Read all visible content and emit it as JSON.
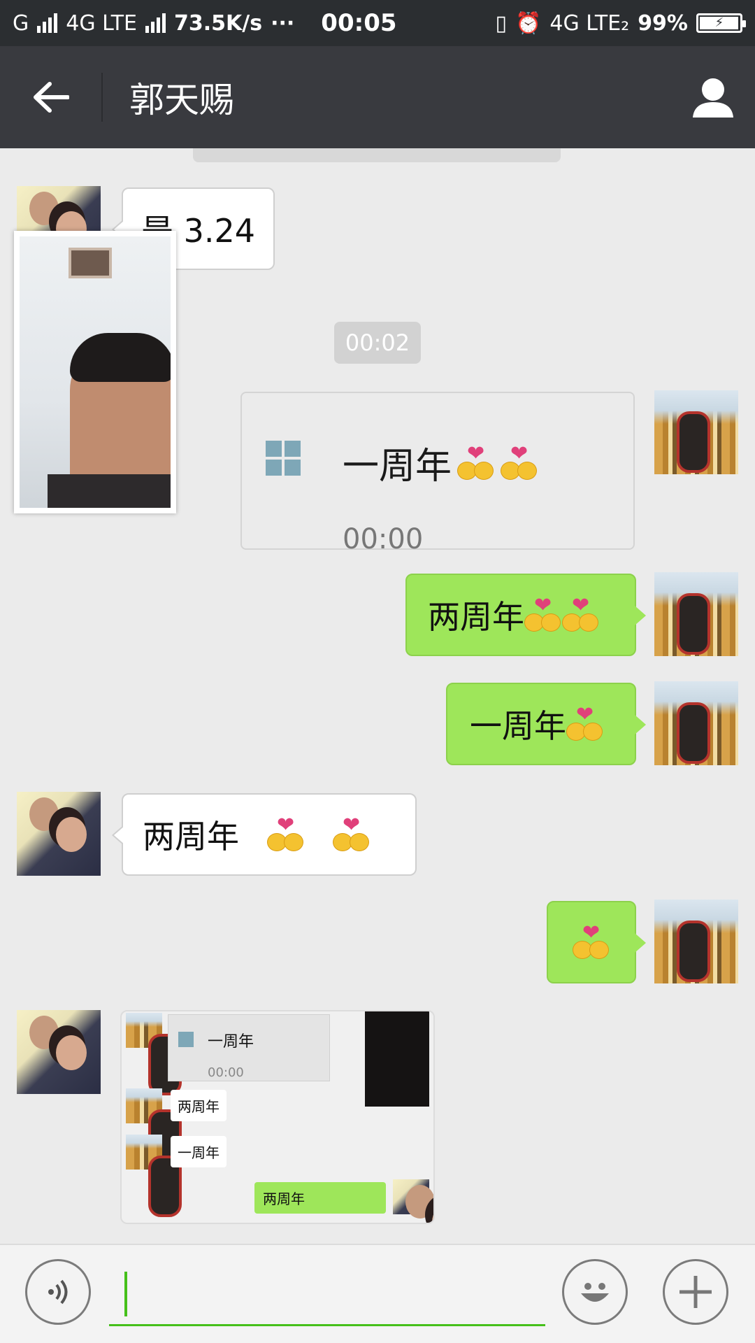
{
  "status_bar": {
    "carrier1": "G",
    "carrier2": "4G LTE",
    "speed": "73.5K/s",
    "dots": "···",
    "time": "00:05",
    "net3": "4G LTE₂",
    "battery": "99%",
    "battery_level": 0.99
  },
  "titlebar": {
    "title": "郭天赐",
    "back_icon": "back-arrow-icon",
    "profile_icon": "person-icon"
  },
  "messages": {
    "m1_text": "是 3.24",
    "video_time": "00:02",
    "card_title": "一周年",
    "card_time": "00:00",
    "m3_text": "两周年",
    "m4_text": "一周年",
    "m5_text": "两周年"
  },
  "image_thumb": {
    "t1": "一周年",
    "t1_time": "00:00",
    "t2": "两周年",
    "t3": "一周年",
    "t4": "两周年"
  },
  "input": {
    "voice_icon": "voice-icon",
    "emoji_icon": "emoji-face-icon",
    "plus_icon": "plus-icon"
  },
  "colors": {
    "titlebar": "#393a3f",
    "bubble_out": "#9ee65a",
    "accent": "#45c01a"
  }
}
